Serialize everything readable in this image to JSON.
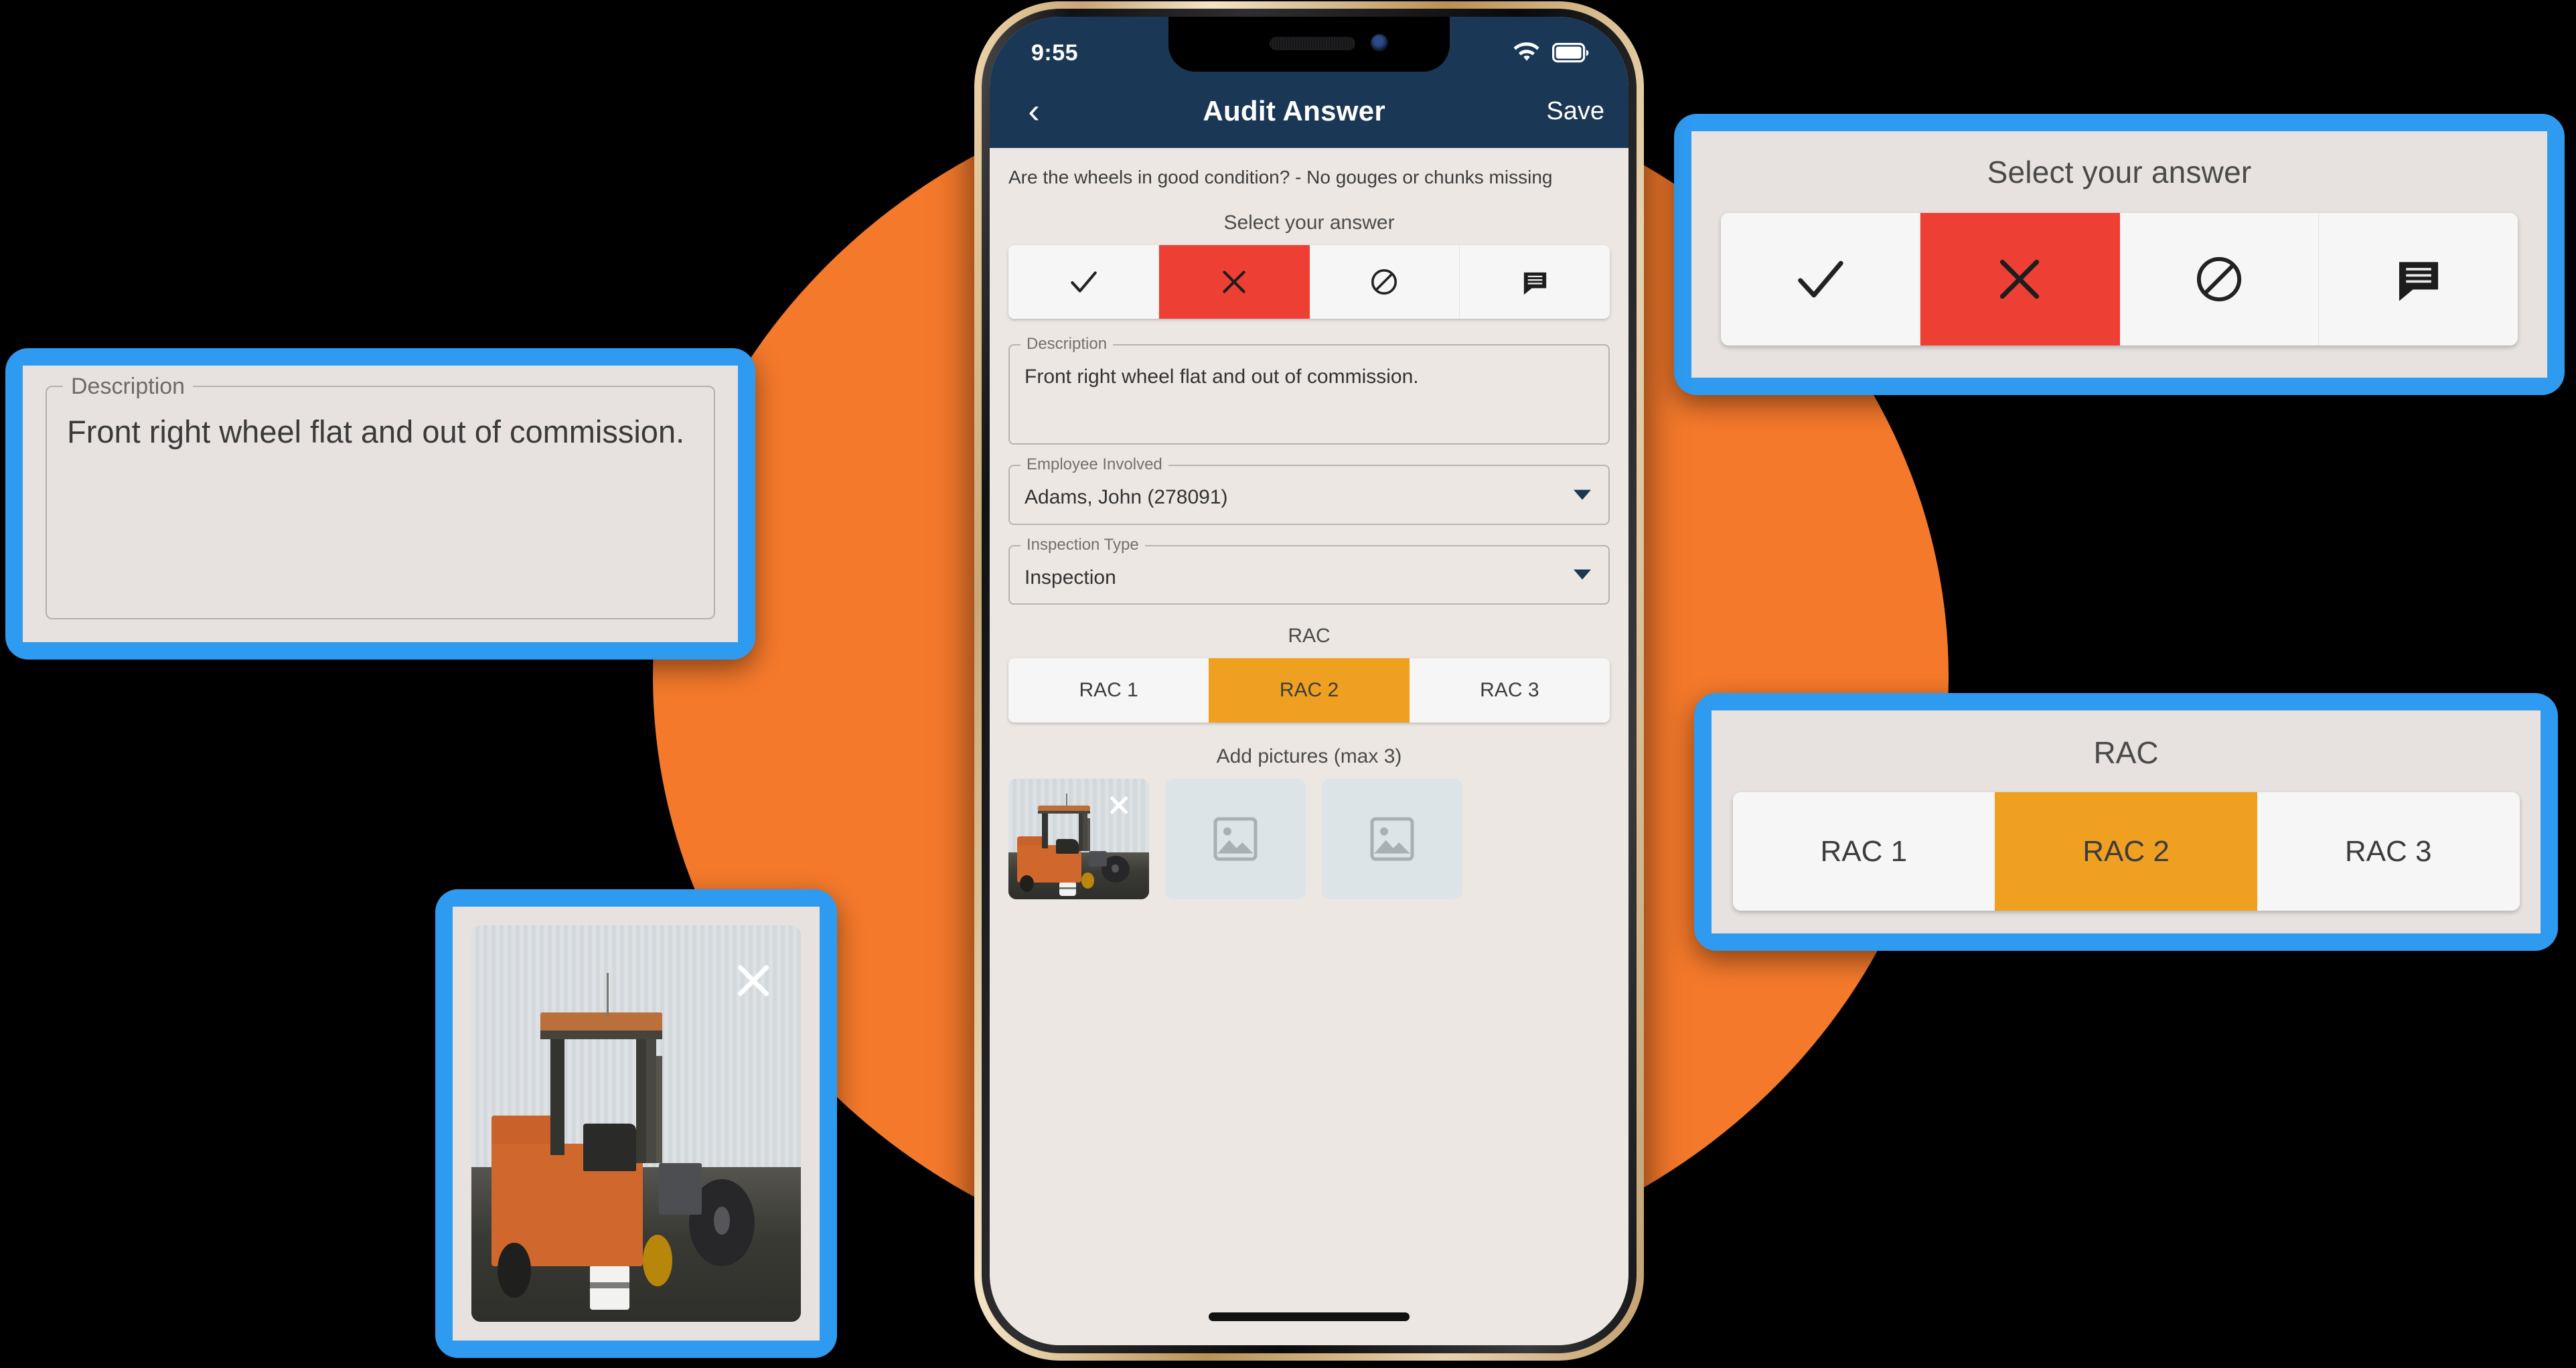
{
  "phone": {
    "status_bar": {
      "time": "9:55",
      "wifi_icon": "wifi-icon",
      "battery_icon": "battery-icon"
    },
    "nav": {
      "back_icon": "chevron-left-icon",
      "title": "Audit Answer",
      "save_label": "Save"
    },
    "question": "Are the wheels in good condition? - No gouges or chunks missing",
    "answer_section": {
      "label": "Select your answer",
      "options": [
        {
          "icon": "check-icon",
          "name": "answer-pass",
          "selected": false
        },
        {
          "icon": "x-icon",
          "name": "answer-fail",
          "selected": true
        },
        {
          "icon": "ban-icon",
          "name": "answer-na",
          "selected": false
        },
        {
          "icon": "comment-icon",
          "name": "answer-comment",
          "selected": false
        }
      ],
      "selected_color": "#ee3f34"
    },
    "description_field": {
      "legend": "Description",
      "value": "Front right wheel flat and out of commission."
    },
    "employee_field": {
      "legend": "Employee Involved",
      "value": "Adams, John (278091)",
      "caret_icon": "chevron-down-icon"
    },
    "inspection_field": {
      "legend": "Inspection Type",
      "value": "Inspection",
      "caret_icon": "chevron-down-icon"
    },
    "rac_section": {
      "label": "RAC",
      "options": [
        {
          "label": "RAC 1",
          "selected": false
        },
        {
          "label": "RAC 2",
          "selected": true
        },
        {
          "label": "RAC 3",
          "selected": false
        }
      ],
      "selected_color": "#f0a020"
    },
    "pictures_section": {
      "label": "Add pictures (max 3)",
      "thumbs": [
        {
          "name": "photo-thumb-filled",
          "filled": true,
          "remove_icon": "close-x-icon"
        },
        {
          "name": "photo-thumb-empty-1",
          "filled": false,
          "placeholder_icon": "image-placeholder-icon"
        },
        {
          "name": "photo-thumb-empty-2",
          "filled": false,
          "placeholder_icon": "image-placeholder-icon"
        }
      ]
    },
    "home_indicator": "home-indicator"
  },
  "callouts": {
    "answer": {
      "title": "Select your answer",
      "options": [
        {
          "icon": "check-icon",
          "selected": false
        },
        {
          "icon": "x-icon",
          "selected": true
        },
        {
          "icon": "ban-icon",
          "selected": false
        },
        {
          "icon": "comment-icon",
          "selected": false
        }
      ]
    },
    "rac": {
      "title": "RAC",
      "options": [
        {
          "label": "RAC 1",
          "selected": false
        },
        {
          "label": "RAC 2",
          "selected": true
        },
        {
          "label": "RAC 3",
          "selected": false
        }
      ]
    },
    "description": {
      "legend": "Description",
      "value": "Front right wheel flat and out of commission."
    },
    "photo": {
      "remove_icon": "close-x-icon",
      "alt": "forklift-photo"
    }
  },
  "colors": {
    "frame_blue": "#2e9bf0",
    "circle_orange": "#f4792b",
    "nav_navy": "#1a3855",
    "fail_red": "#ee3f34",
    "rac_orange": "#f0a020",
    "card_bg": "#e7e2df",
    "screen_bg": "#ece7e3"
  }
}
